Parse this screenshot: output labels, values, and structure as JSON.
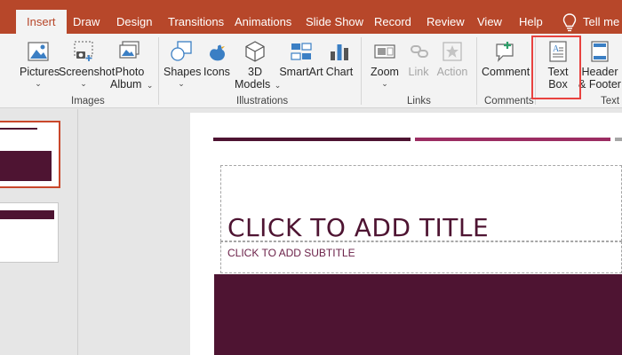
{
  "tabs": [
    {
      "label": "Insert",
      "active": true
    },
    {
      "label": "Draw"
    },
    {
      "label": "Design"
    },
    {
      "label": "Transitions"
    },
    {
      "label": "Animations"
    },
    {
      "label": "Slide Show"
    },
    {
      "label": "Record"
    },
    {
      "label": "Review"
    },
    {
      "label": "View"
    },
    {
      "label": "Help"
    }
  ],
  "tell_me": "Tell me",
  "ribbon": {
    "pictures": {
      "line1": "Pictures",
      "icon": "pictures-icon"
    },
    "screenshot": {
      "line1": "Screenshot",
      "icon": "screenshot-icon"
    },
    "photo_album": {
      "line1": "Photo",
      "line2": "Album",
      "icon": "photo-album-icon"
    },
    "shapes": {
      "line1": "Shapes",
      "icon": "shapes-icon"
    },
    "icons": {
      "line1": "Icons",
      "icon": "icons-icon"
    },
    "models_3d": {
      "line1": "3D",
      "line2": "Models",
      "icon": "cube-icon"
    },
    "smartart": {
      "line1": "SmartArt",
      "icon": "smartart-icon"
    },
    "chart": {
      "line1": "Chart",
      "icon": "chart-icon"
    },
    "zoom": {
      "line1": "Zoom",
      "icon": "zoom-icon"
    },
    "link": {
      "line1": "Link",
      "icon": "link-icon"
    },
    "action": {
      "line1": "Action",
      "icon": "action-icon"
    },
    "comment": {
      "line1": "Comment",
      "icon": "comment-icon"
    },
    "text_box": {
      "line1": "Text",
      "line2": "Box",
      "icon": "text-box-icon"
    },
    "header_footer": {
      "line1": "Header",
      "line2": "& Footer",
      "icon": "header-footer-icon"
    },
    "groups": {
      "images": "Images",
      "illustrations": "Illustrations",
      "links": "Links",
      "comments": "Comments",
      "text": "Text"
    }
  },
  "slide": {
    "title": "CLICK TO ADD TITLE",
    "subtitle": "CLICK TO ADD SUBTITLE"
  },
  "colors": {
    "accent": "#b7472a",
    "theme_dark": "#4e1432",
    "theme_mid": "#9b2d62",
    "highlight": "#e8423f"
  }
}
